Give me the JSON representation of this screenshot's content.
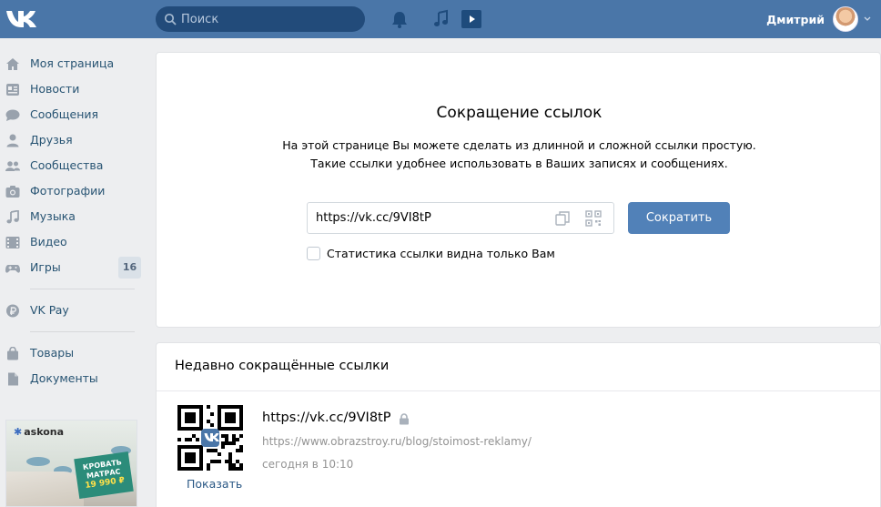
{
  "header": {
    "search_placeholder": "Поиск",
    "user_name": "Дмитрий",
    "icons": [
      "vk-logo-icon",
      "search-icon",
      "bell-icon",
      "music-note-icon",
      "play-icon",
      "chevron-down-icon"
    ]
  },
  "sidebar": {
    "items": [
      {
        "label": "Моя страница",
        "icon": "home-icon"
      },
      {
        "label": "Новости",
        "icon": "news-icon"
      },
      {
        "label": "Сообщения",
        "icon": "chat-icon"
      },
      {
        "label": "Друзья",
        "icon": "user-icon"
      },
      {
        "label": "Сообщества",
        "icon": "group-icon"
      },
      {
        "label": "Фотографии",
        "icon": "camera-icon"
      },
      {
        "label": "Музыка",
        "icon": "music-icon"
      },
      {
        "label": "Видео",
        "icon": "film-icon"
      },
      {
        "label": "Игры",
        "icon": "gamepad-icon",
        "badge": "16"
      }
    ],
    "pay": {
      "label": "VK Pay",
      "icon": "ruble-icon"
    },
    "extra": [
      {
        "label": "Товары",
        "icon": "bag-icon"
      },
      {
        "label": "Документы",
        "icon": "document-icon"
      }
    ],
    "ad": {
      "brand": "askona",
      "promo_line1": "КРОВАТЬ",
      "promo_line2": "МАТРАС",
      "price": "19 990 ₽"
    }
  },
  "shortener": {
    "title": "Сокращение ссылок",
    "desc_line1": "На этой странице Вы можете сделать из длинной и сложной ссылки простую.",
    "desc_line2": "Такие ссылки удобнее использовать в Ваших записях и сообщениях.",
    "link_value": "https://vk.cc/9VI8tP",
    "button_label": "Сократить",
    "checkbox_label": "Статистика ссылки видна только Вам",
    "checkbox_checked": false
  },
  "recent": {
    "title": "Недавно сокращённые ссылки",
    "items": [
      {
        "short_url": "https://vk.cc/9VI8tP",
        "original_url": "https://www.obrazstroy.ru/blog/stoimost-reklamy/",
        "time": "сегодня в 10:10",
        "show_label": "Показать"
      }
    ]
  },
  "colors": {
    "header": "#4a76a8",
    "search_bg": "#224b7a",
    "button": "#5181b8",
    "link": "#2a5885",
    "sidebar_text": "#285473",
    "muted": "#939393"
  }
}
